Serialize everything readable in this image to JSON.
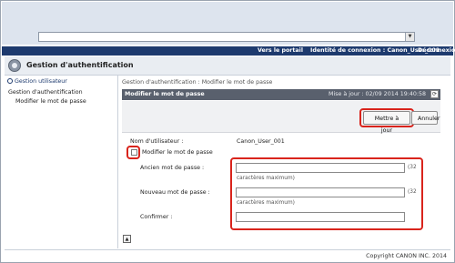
{
  "browser": {
    "address_dropdown_icon": "chevron-down-icon"
  },
  "topbar": {
    "portal_link": "Vers le portail",
    "login_id": "Identité de connexion : Canon_User_001",
    "logout_link": "Déconnexion"
  },
  "app": {
    "title": "Gestion d'authentification",
    "icon": "gear-icon"
  },
  "sidebar": {
    "top_link": "Gestion utilisateur",
    "section": "Gestion d'authentification",
    "item": "Modifier le mot de passe"
  },
  "breadcrumb": "Gestion d'authentification : Modifier le mot de passe",
  "panel": {
    "title": "Modifier le mot de passe",
    "last_update": "Mise à jour : 02/09 2014 19:40:58",
    "refresh_icon": "refresh-icon"
  },
  "buttons": {
    "update": "Mettre à jour",
    "cancel": "Annuler"
  },
  "form": {
    "username_label": "Nom d'utilisateur :",
    "username_value": "Canon_User_001",
    "change_password_label": "Modifier le mot de passe",
    "old_password_label": "Ancien mot de passe :",
    "new_password_label": "Nouveau mot de passe :",
    "confirm_label": "Confirmer :",
    "max_chars_prefix": "(32",
    "max_chars_suffix": "caractères maximum)",
    "old_password_value": "",
    "new_password_value": "",
    "confirm_value": ""
  },
  "footer": {
    "copyright": "Copyright CANON INC. 2014",
    "scroll_top_icon": "arrow-up-icon"
  },
  "colors": {
    "header_navy": "#1d3a6e",
    "panel_header": "#59606d",
    "highlight_red": "#d9241c"
  }
}
